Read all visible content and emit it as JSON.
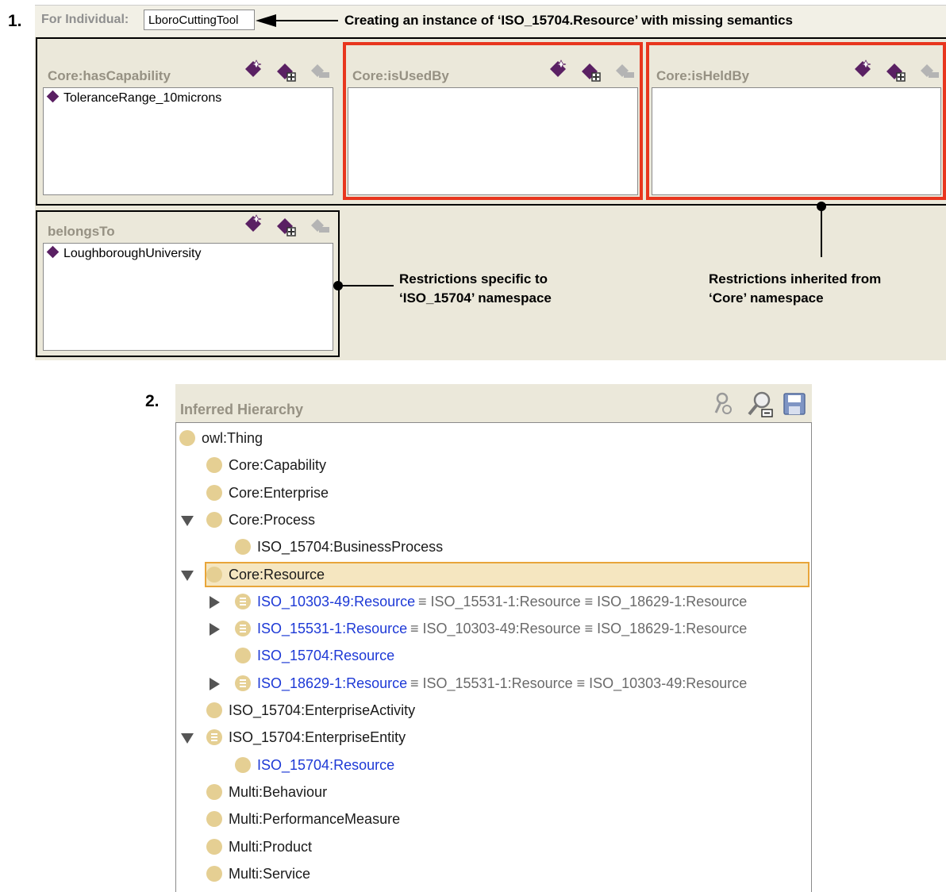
{
  "part1": {
    "number": "1.",
    "for_label": "For Individual:",
    "individual": "LboroCuttingTool",
    "annotation_top": "Creating an instance of ‘ISO_15704.Resource’ with missing semantics",
    "panels": [
      {
        "title": "Core:hasCapability",
        "items": [
          "ToleranceRange_10microns"
        ]
      },
      {
        "title": "Core:isUsedBy",
        "items": []
      },
      {
        "title": "Core:isHeldBy",
        "items": []
      },
      {
        "title": "belongsTo",
        "items": [
          "LoughboroughUniversity"
        ]
      }
    ],
    "annotation_specific_line1": "Restrictions specific to",
    "annotation_specific_line2": "‘ISO_15704’ namespace",
    "annotation_inherited_line1": "Restrictions inherited from",
    "annotation_inherited_line2": "‘Core’ namespace",
    "colors": {
      "highlight": "#e8361e",
      "panel_bg": "#ebe8da",
      "diamond": "#5a2063"
    }
  },
  "part2": {
    "number": "2.",
    "title": "Inferred Hierarchy",
    "toolbar_icons": [
      "wrench-icon",
      "search-icon",
      "save-icon"
    ],
    "rows": [
      {
        "text": "owl:Thing",
        "level": 0,
        "expander": "none",
        "bullet": "plain"
      },
      {
        "text": "Core:Capability",
        "level": 1,
        "expander": "none",
        "bullet": "plain"
      },
      {
        "text": "Core:Enterprise",
        "level": 1,
        "expander": "none",
        "bullet": "plain"
      },
      {
        "text": "Core:Process",
        "level": 1,
        "expander": "down",
        "bullet": "plain"
      },
      {
        "text": "ISO_15704:BusinessProcess",
        "level": 2,
        "expander": "none",
        "bullet": "plain"
      },
      {
        "text": "Core:Resource",
        "level": 1,
        "expander": "down",
        "bullet": "plain",
        "selected": true
      },
      {
        "text": "ISO_10303-49:Resource",
        "extra": " ≡ ISO_15531-1:Resource ≡ ISO_18629-1:Resource",
        "level": 2,
        "expander": "right",
        "bullet": "eq",
        "blue": true
      },
      {
        "text": "ISO_15531-1:Resource",
        "extra": " ≡ ISO_10303-49:Resource ≡ ISO_18629-1:Resource",
        "level": 2,
        "expander": "right",
        "bullet": "eq",
        "blue": true
      },
      {
        "text": "ISO_15704:Resource",
        "level": 2,
        "expander": "none",
        "bullet": "plain",
        "blue": true
      },
      {
        "text": "ISO_18629-1:Resource",
        "extra": " ≡ ISO_15531-1:Resource ≡ ISO_10303-49:Resource",
        "level": 2,
        "expander": "right",
        "bullet": "eq",
        "blue": true
      },
      {
        "text": "ISO_15704:EnterpriseActivity",
        "level": 1,
        "expander": "none",
        "bullet": "plain"
      },
      {
        "text": "ISO_15704:EnterpriseEntity",
        "level": 1,
        "expander": "down",
        "bullet": "eq"
      },
      {
        "text": "ISO_15704:Resource",
        "level": 2,
        "expander": "none",
        "bullet": "plain",
        "blue": true
      },
      {
        "text": "Multi:Behaviour",
        "level": 1,
        "expander": "none",
        "bullet": "plain"
      },
      {
        "text": "Multi:PerformanceMeasure",
        "level": 1,
        "expander": "none",
        "bullet": "plain"
      },
      {
        "text": "Multi:Product",
        "level": 1,
        "expander": "none",
        "bullet": "plain"
      },
      {
        "text": "Multi:Service",
        "level": 1,
        "expander": "none",
        "bullet": "plain"
      }
    ],
    "colors": {
      "selected_bg": "#f5e6c0",
      "selected_border": "#e8a53a",
      "bullet": "#e5cf93",
      "link_blue": "#1d39d6"
    }
  }
}
